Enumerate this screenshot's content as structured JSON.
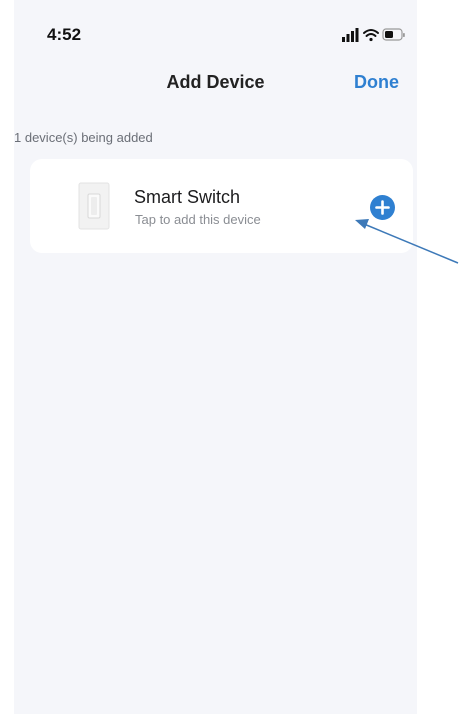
{
  "status": {
    "time": "4:52"
  },
  "nav": {
    "title": "Add Device",
    "done_label": "Done"
  },
  "section": {
    "label": "1 device(s) being added"
  },
  "device": {
    "name": "Smart Switch",
    "subtitle": "Tap to add this device",
    "image": "smart-switch-icon"
  },
  "icons": {
    "signal": "cellular-signal-icon",
    "wifi": "wifi-icon",
    "battery": "battery-icon",
    "add": "plus-circle-icon"
  },
  "colors": {
    "accent": "#2f80d1",
    "background": "#f5f6fa",
    "card": "#ffffff",
    "annotation_arrow": "#3d79b8"
  }
}
